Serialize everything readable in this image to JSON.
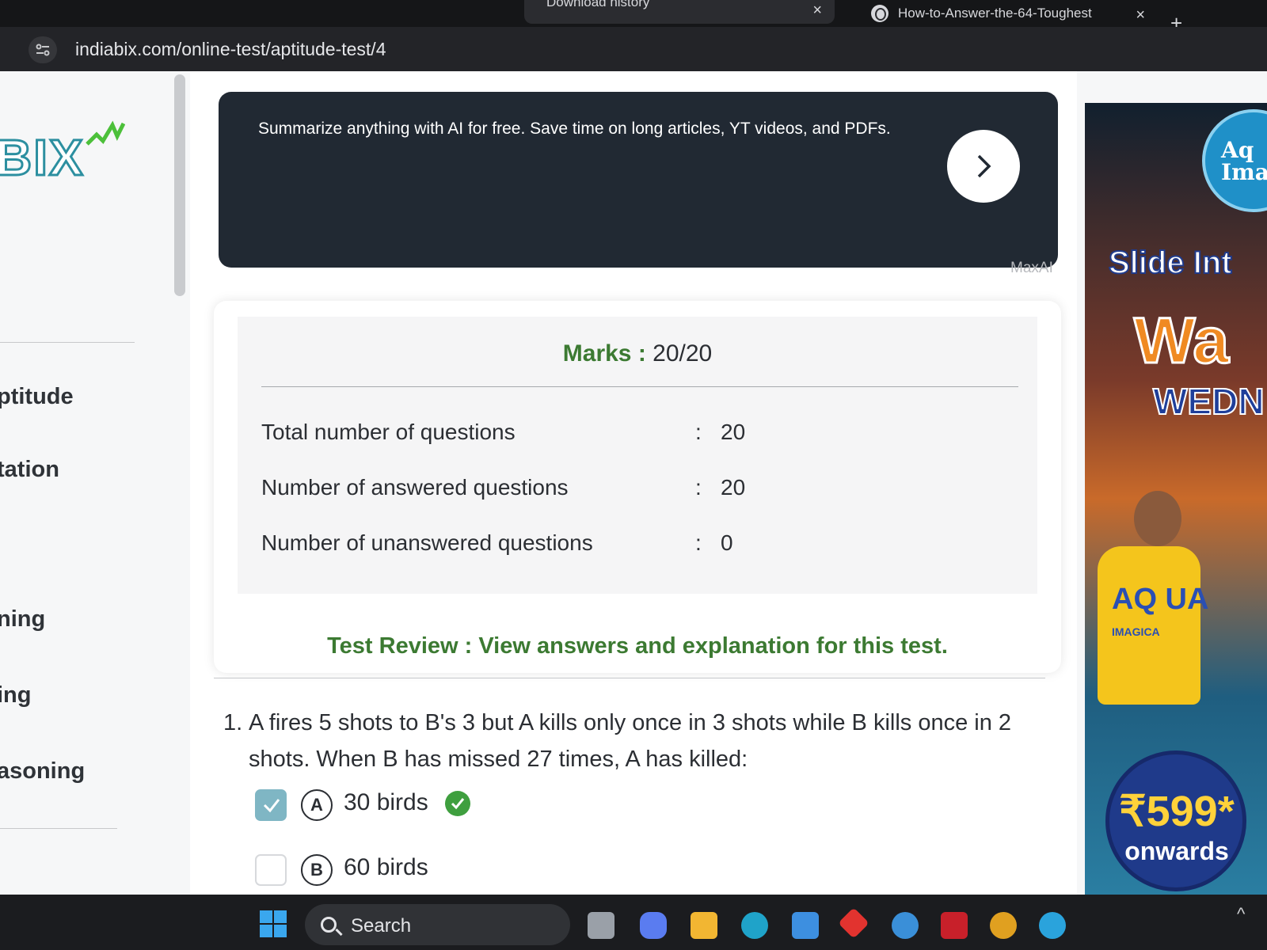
{
  "browser": {
    "tabs": [
      {
        "label": "Download history"
      },
      {
        "label": "How-to-Answer-the-64-Toughest"
      }
    ],
    "close_glyph": "×",
    "new_tab_glyph": "+",
    "url": "indiabix.com/online-test/aptitude-test/4"
  },
  "sidebar": {
    "logo_text": "BIX",
    "items": [
      {
        "label": "ptitude"
      },
      {
        "label": "tation"
      },
      {
        "label": "ning"
      },
      {
        "label": "ing"
      },
      {
        "label": "asoning"
      }
    ]
  },
  "ad_banner": {
    "text": "Summarize anything with AI for free. Save time on long articles, YT videos, and PDFs.",
    "brand": "MaxAI"
  },
  "result": {
    "marks_label": "Marks :",
    "marks_value": "20/20",
    "rows": [
      {
        "label": "Total number of questions",
        "sep": ":",
        "value": "20"
      },
      {
        "label": "Number of answered questions",
        "sep": ":",
        "value": "20"
      },
      {
        "label": "Number of unanswered questions",
        "sep": ":",
        "value": "0"
      }
    ],
    "review_text": "Test Review : View answers and explanation for this test."
  },
  "question": {
    "number": "1.",
    "text": "A fires 5 shots to B's 3 but A kills only once in 3 shots while B kills once in 2 shots. When B has missed 27 times, A has killed:",
    "options": [
      {
        "letter": "A",
        "label": "30 birds",
        "selected": true,
        "correct": true
      },
      {
        "letter": "B",
        "label": "60 birds",
        "selected": false,
        "correct": false
      }
    ]
  },
  "right_ad": {
    "badge": "Aq Imag",
    "headline": "Slide Int",
    "wave": "Wa",
    "day": "WEDN",
    "shirt": "AQ UA",
    "shirt_sub": "IMAGICA",
    "price": "₹599*",
    "price_sub": "onwards"
  },
  "taskbar": {
    "search_label": "Search",
    "overflow_glyph": "^"
  },
  "colors": {
    "accent_green": "#3c7a32",
    "ad_dark": "#212933",
    "checkbox_blue": "#7fb6c4",
    "tick_green": "#3f9f3f"
  }
}
